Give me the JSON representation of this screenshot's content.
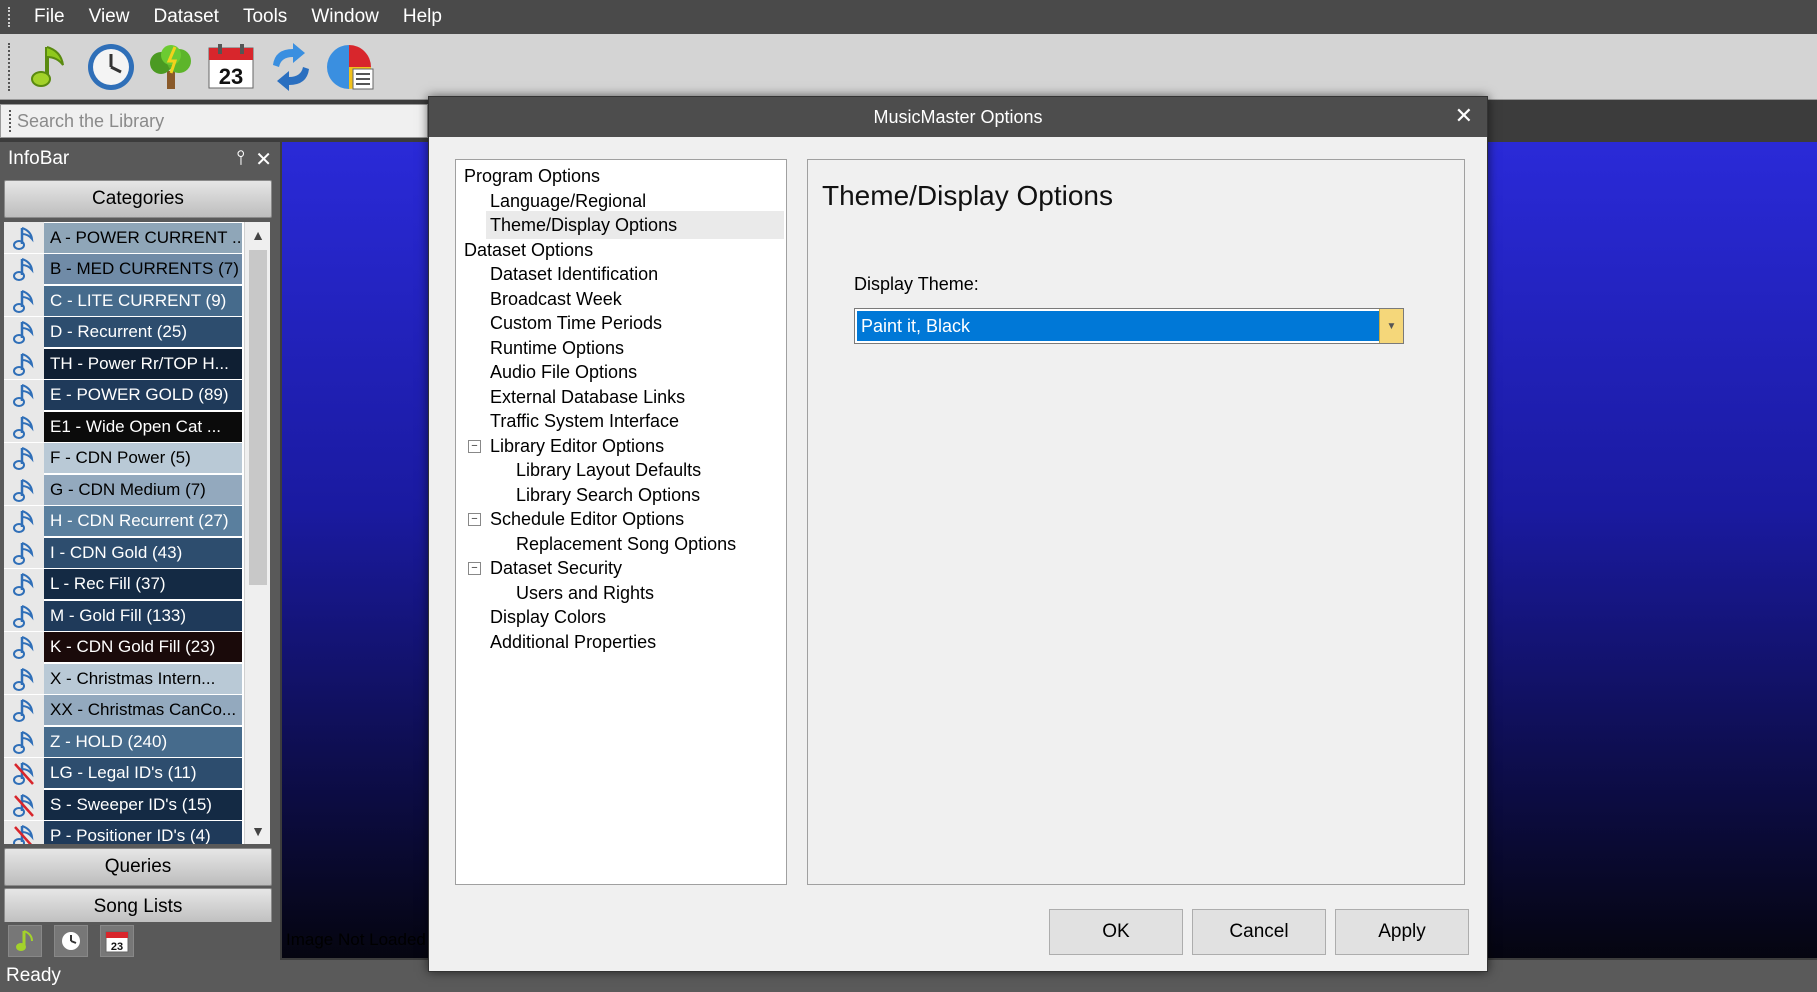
{
  "menu": [
    "File",
    "View",
    "Dataset",
    "Tools",
    "Window",
    "Help"
  ],
  "toolbar": {
    "icons": [
      "music-note-icon",
      "clock-icon",
      "tree-icon",
      "calendar-icon",
      "refresh-icon",
      "chart-icon"
    ],
    "calendar_day": "23"
  },
  "search": {
    "placeholder": "Search the Library"
  },
  "infobar": {
    "title": "InfoBar",
    "pin": "📌",
    "close": "✕",
    "categories_label": "Categories",
    "categories": [
      {
        "label": "A - POWER CURRENT  ...",
        "bg": "#8fa6b8",
        "fg": "#000000",
        "icon": "note"
      },
      {
        "label": "B - MED CURRENTS  (7)",
        "bg": "#708ba7",
        "fg": "#000000",
        "icon": "note"
      },
      {
        "label": "C - LITE CURRENT  (9)",
        "bg": "#466b8c",
        "fg": "#ffffff",
        "icon": "note"
      },
      {
        "label": "D - Recurrent  (25)",
        "bg": "#2d4d6e",
        "fg": "#ffffff",
        "icon": "note"
      },
      {
        "label": "TH - Power Rr/TOP H...",
        "bg": "#0f1f33",
        "fg": "#ffffff",
        "icon": "note"
      },
      {
        "label": "E - POWER GOLD  (89)",
        "bg": "#1f3a5a",
        "fg": "#ffffff",
        "icon": "note"
      },
      {
        "label": "E1 - Wide Open Cat  ...",
        "bg": "#0b0b0b",
        "fg": "#ffffff",
        "icon": "note"
      },
      {
        "label": "F - CDN Power  (5)",
        "bg": "#b9c9d6",
        "fg": "#000000",
        "icon": "note"
      },
      {
        "label": "G - CDN Medium  (7)",
        "bg": "#93a9be",
        "fg": "#000000",
        "icon": "note"
      },
      {
        "label": "H - CDN Recurrent  (27)",
        "bg": "#5a7f9e",
        "fg": "#ffffff",
        "icon": "note"
      },
      {
        "label": "I - CDN Gold  (43)",
        "bg": "#2d4d6e",
        "fg": "#ffffff",
        "icon": "note"
      },
      {
        "label": "L - Rec Fill  (37)",
        "bg": "#142a44",
        "fg": "#ffffff",
        "icon": "note"
      },
      {
        "label": "M - Gold Fill  (133)",
        "bg": "#1f3a5a",
        "fg": "#ffffff",
        "icon": "note"
      },
      {
        "label": "K - CDN Gold Fill  (23)",
        "bg": "#1a0a0a",
        "fg": "#ffffff",
        "icon": "note"
      },
      {
        "label": "X - Christmas Intern...",
        "bg": "#b9c9d6",
        "fg": "#000000",
        "icon": "note"
      },
      {
        "label": "XX - Christmas CanCo...",
        "bg": "#93a9be",
        "fg": "#000000",
        "icon": "note"
      },
      {
        "label": "Z - HOLD  (240)",
        "bg": "#466b8c",
        "fg": "#ffffff",
        "icon": "note"
      },
      {
        "label": "LG - Legal ID's  (11)",
        "bg": "#2d4d6e",
        "fg": "#ffffff",
        "icon": "note-x"
      },
      {
        "label": "S - Sweeper ID's  (15)",
        "bg": "#142a44",
        "fg": "#ffffff",
        "icon": "note-x"
      },
      {
        "label": "P - Positioner ID's  (4)",
        "bg": "#1f3a5a",
        "fg": "#ffffff",
        "icon": "note-x"
      }
    ],
    "queries_label": "Queries",
    "songlists_label": "Song Lists",
    "bottom_calendar_day": "23"
  },
  "main": {
    "image_status": "Image Not Loaded"
  },
  "status": {
    "text": "Ready"
  },
  "dialog": {
    "title": "MusicMaster Options",
    "close": "✕",
    "tree": [
      {
        "label": "Program Options",
        "level": 0
      },
      {
        "label": "Language/Regional",
        "level": 1
      },
      {
        "label": "Theme/Display Options",
        "level": 1,
        "selected": true
      },
      {
        "label": "Dataset Options",
        "level": 0
      },
      {
        "label": "Dataset Identification",
        "level": 1
      },
      {
        "label": "Broadcast Week",
        "level": 1
      },
      {
        "label": "Custom Time Periods",
        "level": 1
      },
      {
        "label": "Runtime Options",
        "level": 1
      },
      {
        "label": "Audio File Options",
        "level": 1
      },
      {
        "label": "External Database Links",
        "level": 1
      },
      {
        "label": "Traffic System Interface",
        "level": 1
      },
      {
        "label": "Library Editor Options",
        "level": 1,
        "toggle": "−"
      },
      {
        "label": "Library Layout Defaults",
        "level": 2
      },
      {
        "label": "Library Search Options",
        "level": 2
      },
      {
        "label": "Schedule Editor Options",
        "level": 1,
        "toggle": "−"
      },
      {
        "label": "Replacement Song Options",
        "level": 2
      },
      {
        "label": "Dataset Security",
        "level": 1,
        "toggle": "−"
      },
      {
        "label": "Users and Rights",
        "level": 2
      },
      {
        "label": "Display Colors",
        "level": 1
      },
      {
        "label": "Additional Properties",
        "level": 1
      }
    ],
    "panel_title": "Theme/Display Options",
    "theme_label": "Display Theme:",
    "theme_value": "Paint it, Black",
    "ok_label": "OK",
    "cancel_label": "Cancel",
    "apply_label": "Apply"
  },
  "colors": {
    "accent": "#0078d7",
    "combo_button": "#f5d77a"
  }
}
